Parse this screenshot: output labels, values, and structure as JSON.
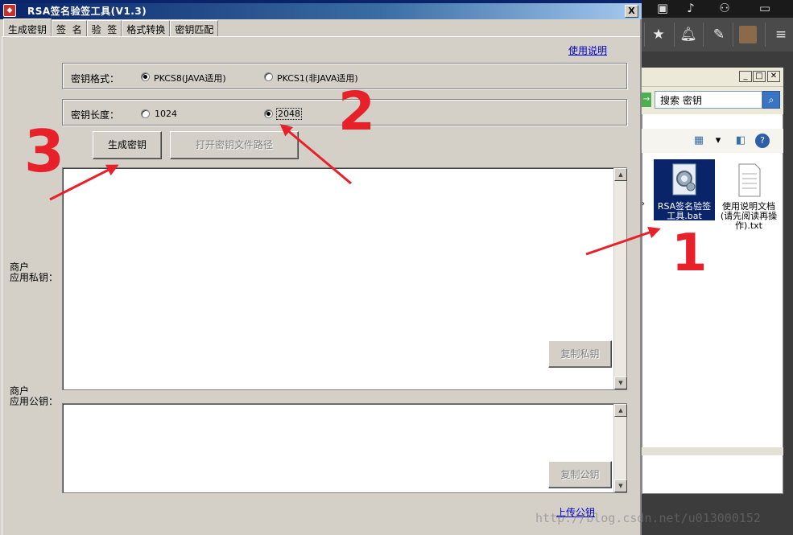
{
  "window": {
    "title": "RSA签名验签工具(V1.3)",
    "close_label": "X"
  },
  "tabs": [
    "生成密钥",
    "签  名",
    "验  签",
    "格式转换",
    "密钥匹配"
  ],
  "usage_link": "使用说明",
  "key_format": {
    "label": "密钥格式：",
    "options": [
      "PKCS8(JAVA适用)",
      "PKCS1(非JAVA适用)"
    ],
    "selected": 0
  },
  "key_length": {
    "label": "密钥长度：",
    "options": [
      "1024",
      "2048"
    ],
    "selected": 1
  },
  "buttons": {
    "generate": "生成密钥",
    "open_path": "打开密钥文件路径",
    "copy_private": "复制私钥",
    "copy_public": "复制公钥"
  },
  "private_key": {
    "label_line1": "商户",
    "label_line2": "应用私钥：",
    "value": ""
  },
  "public_key": {
    "label_line1": "商户",
    "label_line2": "应用公钥：",
    "value": ""
  },
  "upload_link": "上传公钥",
  "explorer": {
    "search_placeholder": "搜索 密钥",
    "files": [
      {
        "name": "RSA签名验签工具.bat",
        "icon": "gear-file-icon",
        "selected": true
      },
      {
        "name": "使用说明文档(请先阅读再操作).txt",
        "icon": "text-file-icon",
        "selected": false
      }
    ]
  },
  "annotations": [
    "1",
    "2",
    "3"
  ],
  "watermark": "http://blog.csdn.net/u013000152",
  "colors": {
    "annotation": "#e8202a",
    "titlebar": "#0a246a",
    "link": "#0000cc"
  }
}
